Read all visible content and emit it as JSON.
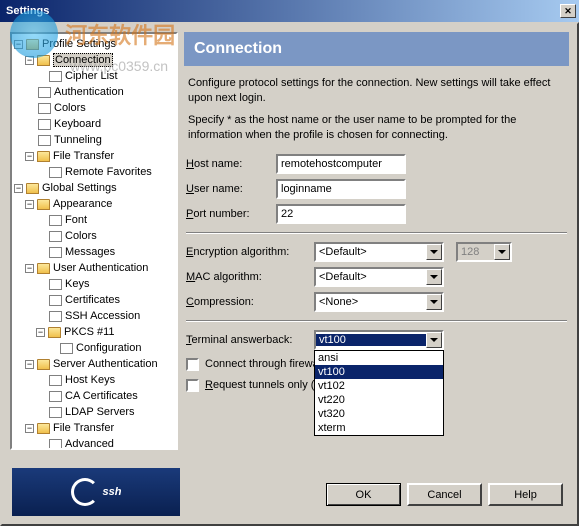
{
  "title": "Settings",
  "watermark": {
    "text": "河东软件园",
    "url": "www.pc0359.cn"
  },
  "tree": {
    "profile_settings": "Profile Settings",
    "connection": "Connection",
    "cipher_list": "Cipher List",
    "authentication": "Authentication",
    "colors": "Colors",
    "keyboard": "Keyboard",
    "tunneling": "Tunneling",
    "file_transfer": "File Transfer",
    "remote_favorites": "Remote Favorites",
    "global_settings": "Global Settings",
    "appearance": "Appearance",
    "font": "Font",
    "colors2": "Colors",
    "messages": "Messages",
    "user_authentication": "User Authentication",
    "keys": "Keys",
    "certificates": "Certificates",
    "ssh_accession": "SSH Accession",
    "pkcs11": "PKCS #11",
    "configuration": "Configuration",
    "server_authentication": "Server Authentication",
    "host_keys": "Host Keys",
    "ca_certificates": "CA Certificates",
    "ldap_servers": "LDAP Servers",
    "file_transfer2": "File Transfer",
    "advanced": "Advanced"
  },
  "panel": {
    "title": "Connection",
    "desc1": "Configure protocol settings for the connection. New settings will take effect upon next login.",
    "desc2": "Specify * as the host name or the user name to be prompted for the information when the profile is chosen for connecting.",
    "host_label": "Host name:",
    "host_value": "remotehostcomputer",
    "user_label": "User name:",
    "user_value": "loginname",
    "port_label": "Port number:",
    "port_value": "22",
    "enc_label": "Encryption algorithm:",
    "enc_value": "<Default>",
    "enc_bits": "128",
    "mac_label": "MAC algorithm:",
    "mac_value": "<Default>",
    "comp_label": "Compression:",
    "comp_value": "<None>",
    "term_label": "Terminal answerback:",
    "term_value": "vt100",
    "term_options": [
      "ansi",
      "vt100",
      "vt102",
      "vt220",
      "vt320",
      "xterm"
    ],
    "firewall_label": "Connect through firewall",
    "tunnels_label": "Request tunnels only (dis"
  },
  "buttons": {
    "ok": "OK",
    "cancel": "Cancel",
    "help": "Help"
  },
  "logo": "ssh"
}
